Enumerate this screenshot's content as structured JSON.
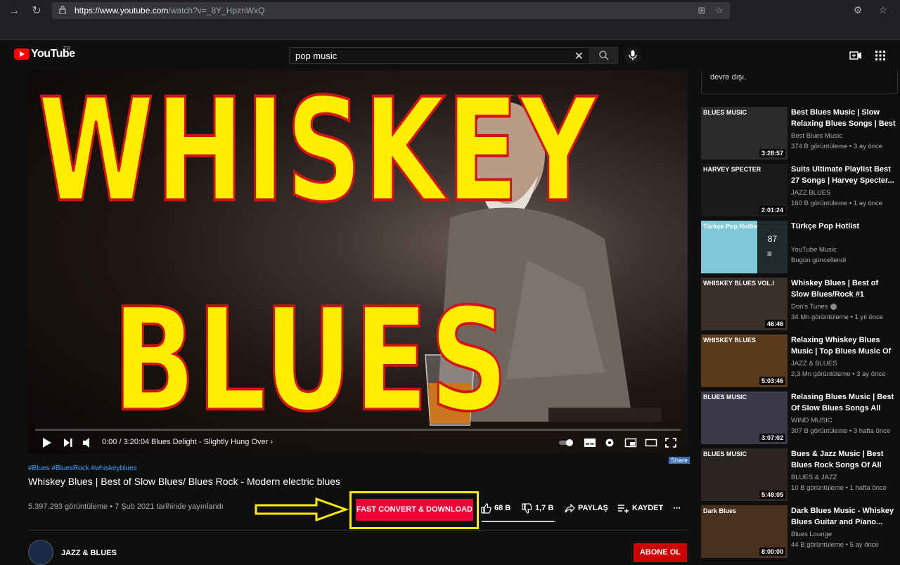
{
  "browser": {
    "url_host": "https://www.youtube.com",
    "url_path": "/watch?v=_8Y_HpznWxQ"
  },
  "header": {
    "wordmark": "YouTube",
    "country": "TR",
    "search_value": "pop music"
  },
  "player": {
    "art_title_top": "WHISKEY",
    "art_title_bottom": "BLUES",
    "time": "0:00 / 3:20:04",
    "chapter": "Blues Delight - Slightly Hung Over",
    "progress": 0
  },
  "share_tag": "Share",
  "video": {
    "hashtags": "#Blues #BluesRock #whiskeyblues",
    "title": "Whiskey Blues | Best of Slow Blues/ Blues Rock - Modern electric blues",
    "views": "5.397.293 görüntüleme • 7 Şub 2021 tarihinde yayınlandı",
    "convert_label": "FAST CONVERT & DOWNLOAD",
    "likes": "68 B",
    "dislikes": "1,7 B",
    "share": "PAYLAŞ",
    "save": "KAYDET",
    "like_ratio": 0.97
  },
  "channel": {
    "name": "JAZZ & BLUES",
    "subscribe": "ABONE OL"
  },
  "sidebar": {
    "chat_note": "devre dışı.",
    "items": [
      {
        "title": "Best Blues Music | Slow Relaxing Blues Songs | Best ...",
        "channel": "Best Blues Music",
        "meta": "374 B görüntüleme • 3 ay önce",
        "duration": "3:28:57",
        "thumb_label": "BLUES MUSIC",
        "thumb_color": "#2a2a2a"
      },
      {
        "title": "Suits Ultimate Playlist Best 27 Songs | Harvey Specter...",
        "channel": "JAZZ BLUES",
        "meta": "160 B görüntüleme • 1 ay önce",
        "duration": "2:01:24",
        "thumb_label": "HARVEY SPECTER",
        "thumb_color": "#1a1a1a"
      },
      {
        "title": "Türkçe Pop Hotlist",
        "channel": "YouTube Music",
        "meta": "Bugün güncellendi",
        "duration": "",
        "thumb_label": "Türkçe Pop Hotlist",
        "thumb_color": "#7ec8d8",
        "playlist_count": "87"
      },
      {
        "title": "Whiskey Blues | Best of Slow Blues/Rock #1",
        "channel": "Don's Tunes",
        "meta": "34 Mn görüntüleme • 1 yıl önce",
        "duration": "46:46",
        "thumb_label": "WHISKEY BLUES VOL.I",
        "thumb_color": "#3a2e28"
      },
      {
        "title": "Relaxing Whiskey Blues Music | Top Blues Music Of All Time",
        "channel": "JAZZ & BLUES",
        "meta": "2,3 Mn görüntüleme • 3 ay önce",
        "duration": "5:03:46",
        "thumb_label": "WHISKEY BLUES",
        "thumb_color": "#5a3a1a"
      },
      {
        "title": "Relasing Blues Music | Best Of Slow Blues Songs All Time |...",
        "channel": "WIND MUSIC",
        "meta": "307 B görüntüleme • 3 hafta önce",
        "duration": "3:07:02",
        "thumb_label": "BLUES MUSIC",
        "thumb_color": "#3a3a48"
      },
      {
        "title": "Bues & Jazz Music | Best Blues Rock Songs Of All Tim...",
        "channel": "BLUES & JAZZ",
        "meta": "10 B görüntüleme • 1 hafta önce",
        "duration": "5:48:05",
        "thumb_label": "BLUES MUSIC",
        "thumb_color": "#2c2420"
      },
      {
        "title": "Dark Blues Music - Whiskey Blues Guitar and Piano...",
        "channel": "Blues Lounge",
        "meta": "44 B görüntüleme • 5 ay önce",
        "duration": "8:00:00",
        "thumb_label": "Dark Blues",
        "thumb_color": "#4a3020"
      }
    ]
  }
}
